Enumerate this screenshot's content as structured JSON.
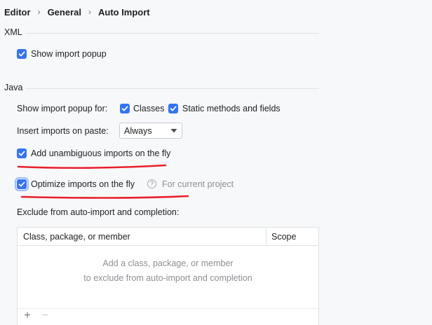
{
  "breadcrumb": {
    "items": [
      "Editor",
      "General",
      "Auto Import"
    ],
    "separator": "›"
  },
  "xml_section": {
    "title": "XML",
    "show_import_popup": {
      "label": "Show import popup",
      "checked": true
    }
  },
  "java_section": {
    "title": "Java",
    "show_popup_for_label": "Show import popup for:",
    "classes": {
      "label": "Classes",
      "checked": true
    },
    "static_methods": {
      "label": "Static methods and fields",
      "checked": true
    },
    "insert_on_paste": {
      "label": "Insert imports on paste:",
      "selected": "Always"
    },
    "add_unambiguous": {
      "label": "Add unambiguous imports on the fly",
      "checked": true
    },
    "optimize_imports": {
      "label": "Optimize imports on the fly",
      "checked": true,
      "help_glyph": "?",
      "scope_hint": "For current project"
    },
    "exclude_label": "Exclude from auto-import and completion:"
  },
  "exclude_table": {
    "columns": [
      "Class, package, or member",
      "Scope"
    ],
    "rows": [],
    "empty_line1": "Add a class, package, or member",
    "empty_line2": "to exclude from auto-import and completion",
    "add_glyph": "+",
    "remove_glyph": "−"
  },
  "colors": {
    "accent": "#3574f0",
    "annotation": "#e8202a",
    "background": "#f7f8fa"
  },
  "icons": {
    "checkbox_check": "check-icon",
    "select_chevron": "chevron-down-icon",
    "help": "help-icon",
    "add": "plus-icon",
    "remove": "minus-icon"
  }
}
